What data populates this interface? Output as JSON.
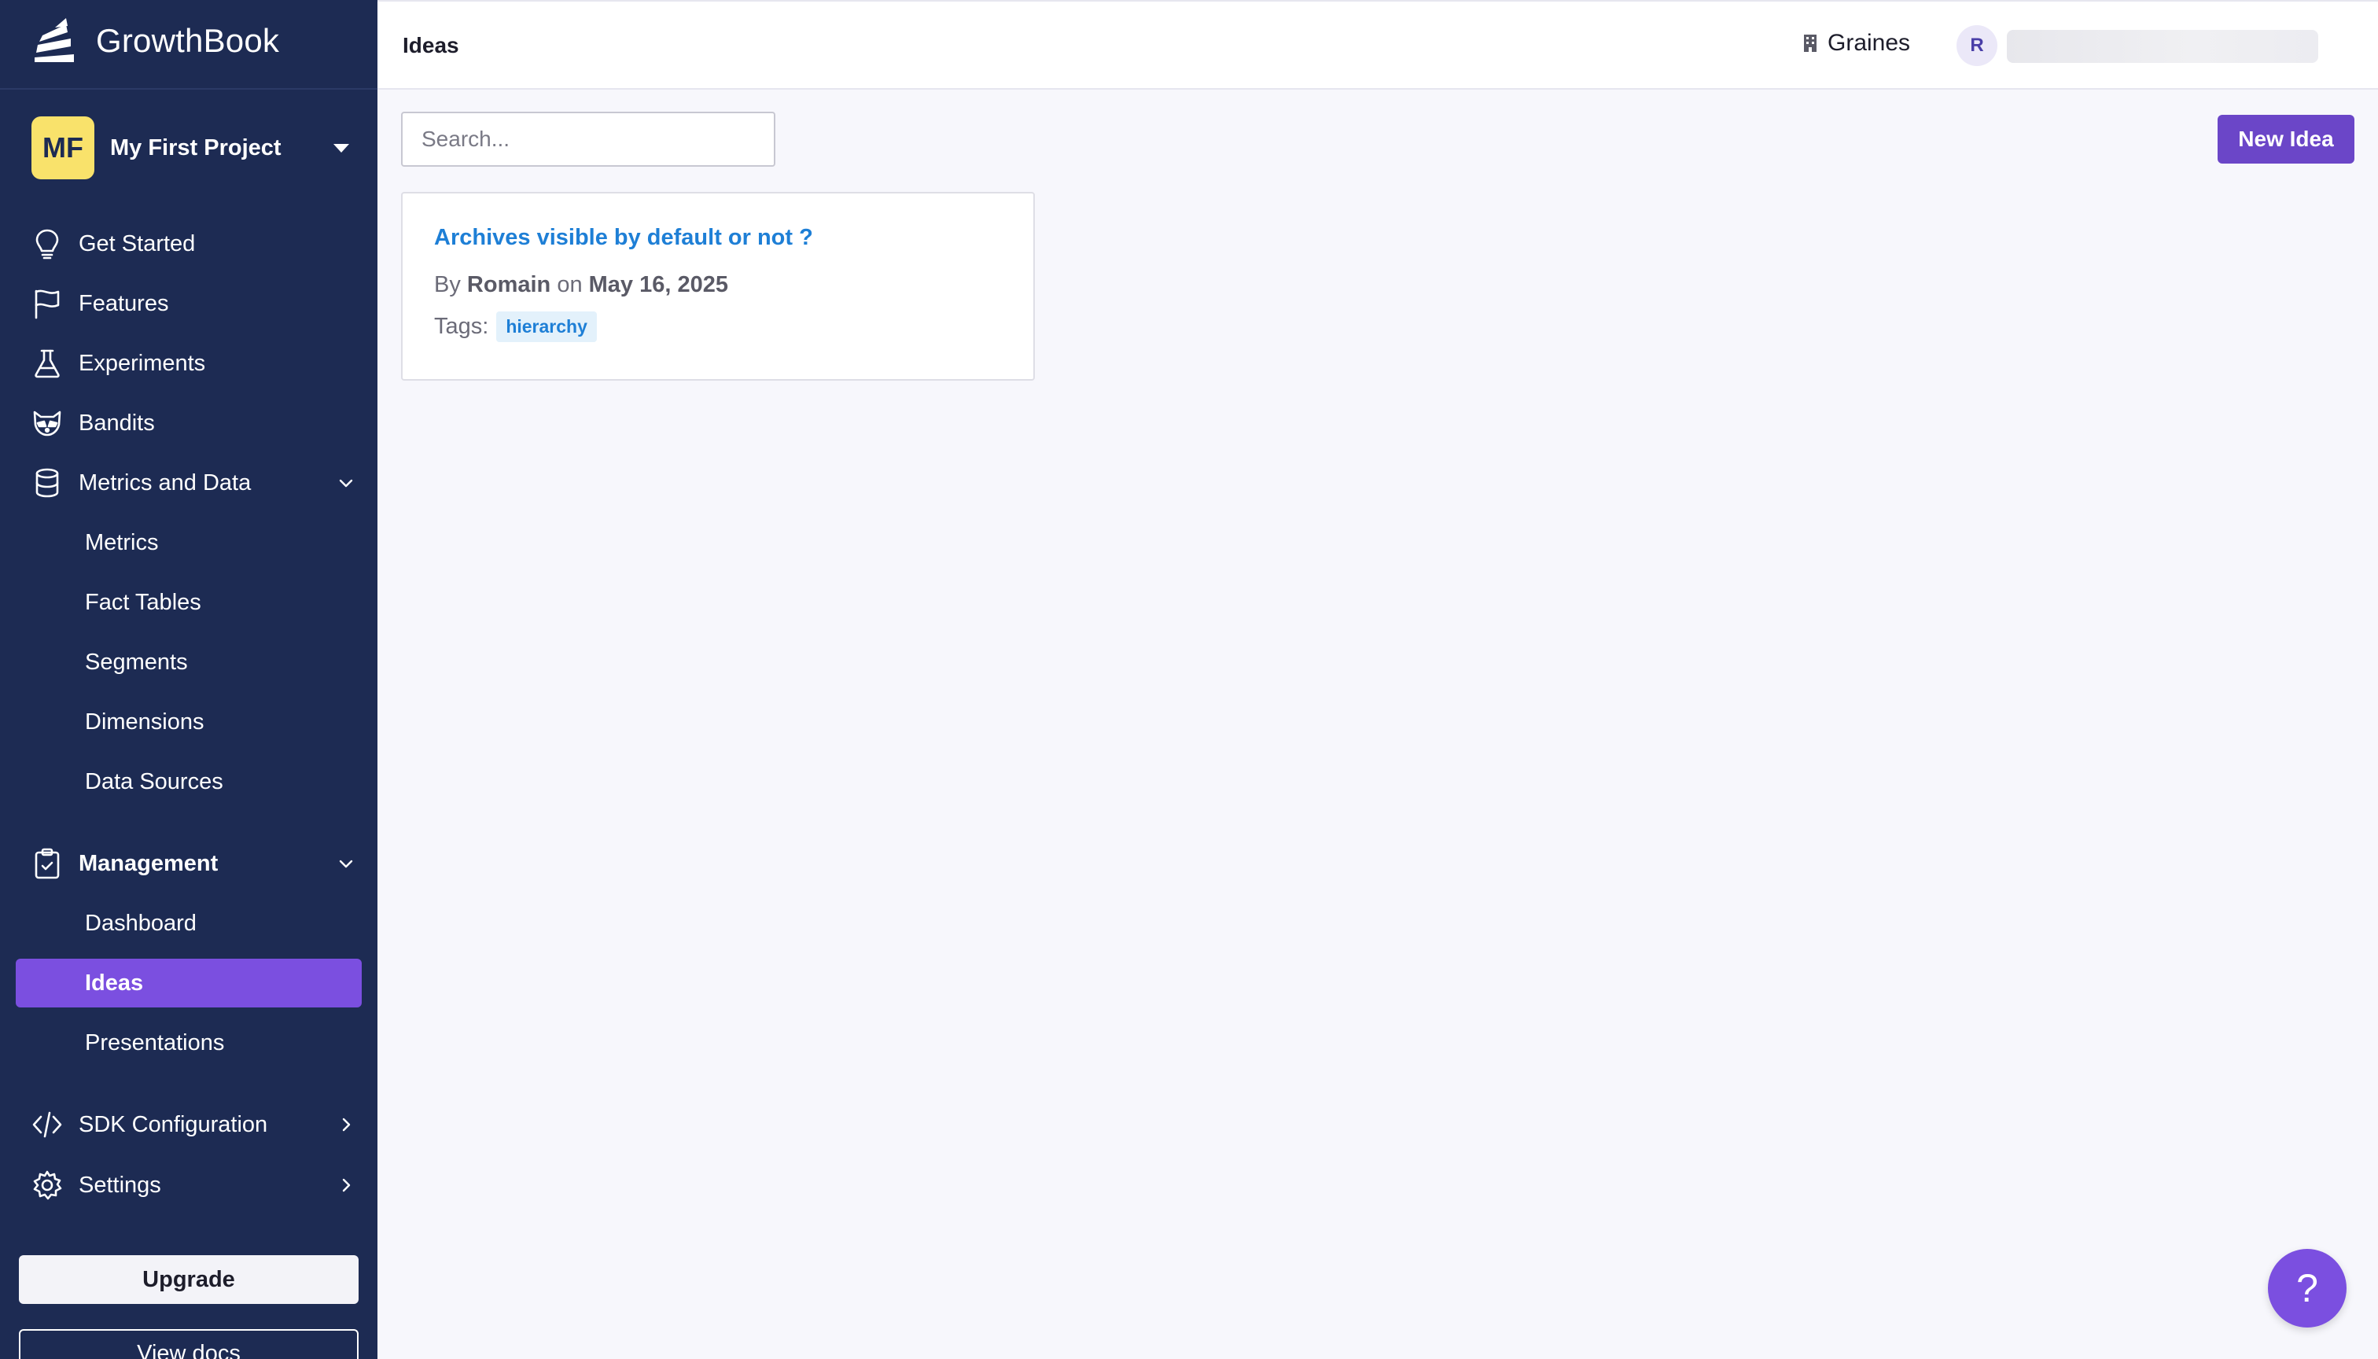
{
  "app": {
    "name": "GrowthBook"
  },
  "project": {
    "initials": "MF",
    "name": "My First Project"
  },
  "sidebar": {
    "items": [
      {
        "label": "Get Started",
        "icon": "lightbulb-icon"
      },
      {
        "label": "Features",
        "icon": "flag-icon"
      },
      {
        "label": "Experiments",
        "icon": "flask-icon"
      },
      {
        "label": "Bandits",
        "icon": "raccoon-icon"
      },
      {
        "label": "Metrics and Data",
        "icon": "database-icon",
        "expanded": true,
        "children": [
          "Metrics",
          "Fact Tables",
          "Segments",
          "Dimensions",
          "Data Sources"
        ]
      },
      {
        "label": "Management",
        "icon": "clipboard-check-icon",
        "expanded": true,
        "children": [
          "Dashboard",
          "Ideas",
          "Presentations"
        ]
      },
      {
        "label": "SDK Configuration",
        "icon": "code-icon",
        "expanded": false
      },
      {
        "label": "Settings",
        "icon": "gear-icon",
        "expanded": false
      }
    ],
    "active": "Ideas",
    "upgrade_label": "Upgrade",
    "docs_label": "View docs"
  },
  "header": {
    "title": "Ideas",
    "org": "Graines",
    "user_initial": "R"
  },
  "main": {
    "search_placeholder": "Search...",
    "new_button": "New Idea",
    "ideas": [
      {
        "title": "Archives visible by default or not ?",
        "by_label": "By",
        "author": "Romain",
        "on_label": "on",
        "date": "May 16, 2025",
        "tags_label": "Tags:",
        "tags": [
          "hierarchy"
        ]
      }
    ]
  },
  "help": {
    "label": "?"
  },
  "colors": {
    "sidebar_bg": "#1d2b53",
    "accent": "#7b4fe0",
    "button": "#6b46c8",
    "link": "#1e7fd6",
    "project_avatar": "#f9e26b"
  }
}
